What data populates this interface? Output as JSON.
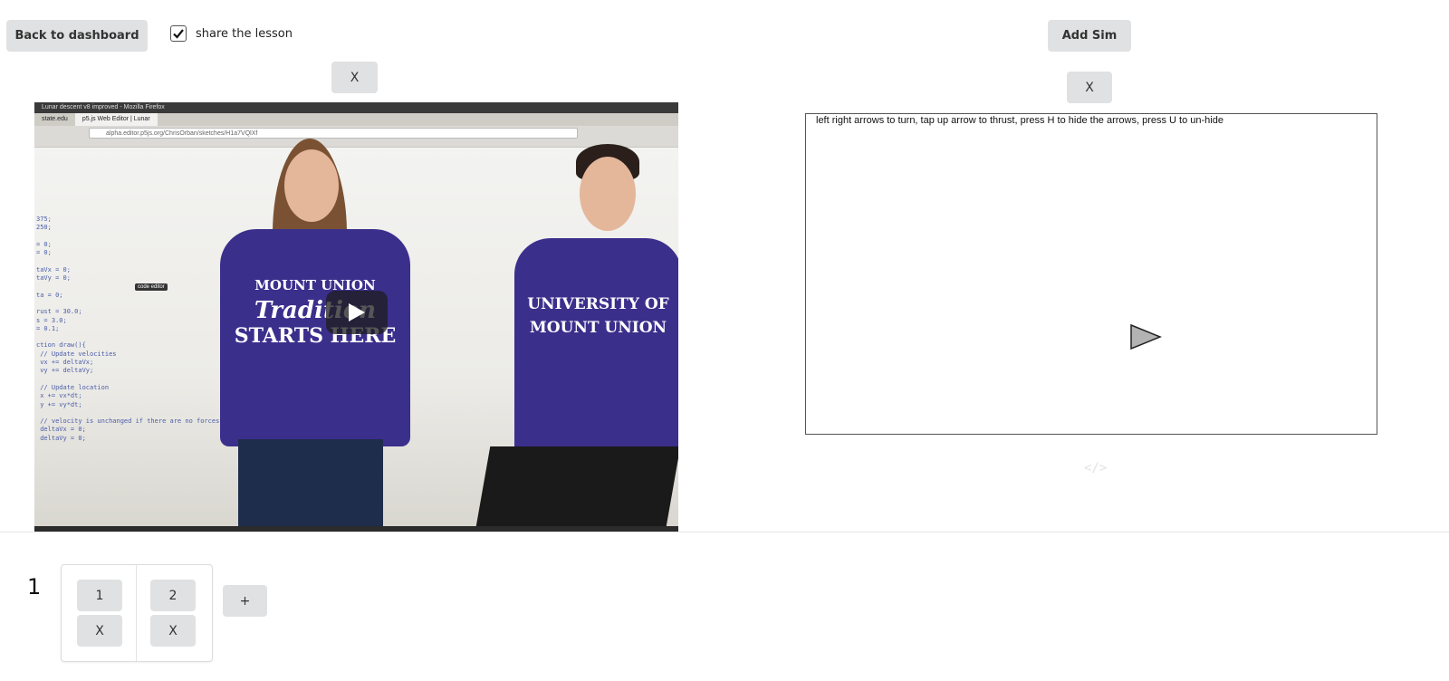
{
  "toolbar": {
    "back_label": "Back to dashboard",
    "share_label": "share the lesson",
    "share_checked": true,
    "add_sim_label": "Add Sim"
  },
  "video": {
    "close_label": "X",
    "browser_title": "Lunar descent v8 improved - Mozilla Firefox",
    "tab_label": "p5.js Web Editor | Lunar",
    "url": "alpha.editor.p5js.org/ChrisOrban/sketches/H1a7VQlXf",
    "tooltip": "code editor",
    "shirt_left_text": [
      "MOUNT UNION",
      "Tradition",
      "STARTS HERE"
    ],
    "shirt_right_text": [
      "UNIVERSITY OF",
      "MOUNT UNION"
    ],
    "play_icon": "play-icon"
  },
  "sim": {
    "close_label": "X",
    "instructions": "left right arrows to turn, tap up arrow to thrust, press H to hide the arrows, press U to un-hide",
    "ship_color": "#b3b3b3",
    "embed_icon_text": "</>"
  },
  "lesson": {
    "section_number": "1",
    "slides": [
      {
        "label": "1",
        "remove_label": "X"
      },
      {
        "label": "2",
        "remove_label": "X"
      }
    ],
    "add_slide_label": "+"
  },
  "colors": {
    "button_bg": "#e0e1e2",
    "shirt_purple": "#3b2f8c"
  }
}
